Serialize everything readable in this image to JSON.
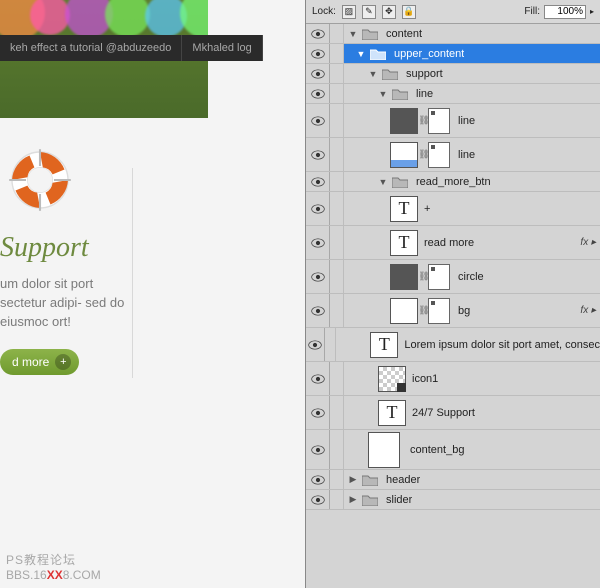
{
  "tabs": [
    "keh effect a tutorial @abduzeedo",
    "Mkhaled log"
  ],
  "support": {
    "title": "Support",
    "body": "um dolor sit port sectetur adipi- sed do eiusmoc ort!",
    "btn_label": "d more",
    "btn_plus": "+"
  },
  "watermark": {
    "line1": "PS教程论坛",
    "line2a": "BBS.16",
    "line2b": "XX",
    "line2c": "8.COM"
  },
  "panel": {
    "lock_label": "Lock:",
    "fill_label": "Fill:",
    "fill_value": "100%"
  },
  "layers": {
    "content": "content",
    "upper_content": "upper_content",
    "support": "support",
    "line_grp": "line",
    "line1": "line",
    "line2": "line",
    "read_more_grp": "read_more_btn",
    "plus": "+",
    "read_more": "read more",
    "circle": "circle",
    "bg": "bg",
    "lorem": "Lorem ipsum dolor sit port amet, consec",
    "icon1": "icon1",
    "support_txt": "24/7 Support",
    "content_bg": "content_bg",
    "header": "header",
    "slider": "slider"
  }
}
